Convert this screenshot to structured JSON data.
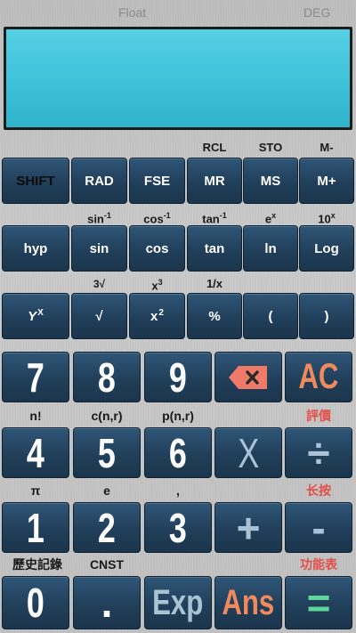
{
  "status": {
    "mode": "Float",
    "angle": "DEG"
  },
  "display": {
    "expression": "",
    "result": ""
  },
  "row1_labels": [
    "",
    "",
    "",
    "RCL",
    "STO",
    "M-"
  ],
  "row1_keys": [
    "SHIFT",
    "RAD",
    "FSE",
    "MR",
    "MS",
    "M+"
  ],
  "row2_labels": [
    "",
    "sin",
    "cos",
    "tan",
    "e",
    "10"
  ],
  "row2_label_sups": [
    "",
    "-1",
    "-1",
    "-1",
    "x",
    "x"
  ],
  "row2_keys": [
    "hyp",
    "sin",
    "cos",
    "tan",
    "ln",
    "Log"
  ],
  "row3_labels": [
    "",
    "3√",
    "x",
    "1/x",
    "",
    ""
  ],
  "row3_label_sups": [
    "",
    "",
    "3",
    "",
    "",
    ""
  ],
  "row3_keys": [
    "Y",
    "√",
    "x",
    "%",
    "(",
    ")"
  ],
  "row3_key_sups": [
    "X",
    "",
    "2",
    "",
    "",
    ""
  ],
  "num_row1": [
    "7",
    "8",
    "9",
    "",
    "AC"
  ],
  "num_row2_labels": [
    "n!",
    "c(n,r)",
    "p(n,r)",
    "",
    "評價"
  ],
  "num_row2": [
    "4",
    "5",
    "6",
    "X",
    "÷"
  ],
  "num_row3_labels": [
    "π",
    "e",
    ",",
    "",
    "长按"
  ],
  "num_row3": [
    "1",
    "2",
    "3",
    "+",
    "-"
  ],
  "num_row4_labels": [
    "歷史記錄",
    "CNST",
    "",
    "",
    "功能表"
  ],
  "num_row4": [
    "0",
    ".",
    "Exp",
    "Ans",
    "="
  ],
  "colors": {
    "key_blue": "#213f5a",
    "display_cyan": "#3fc2d9",
    "accent_red": "#e2504a",
    "ans_orange": "#f08a5c",
    "equals_green": "#5fd49c"
  }
}
